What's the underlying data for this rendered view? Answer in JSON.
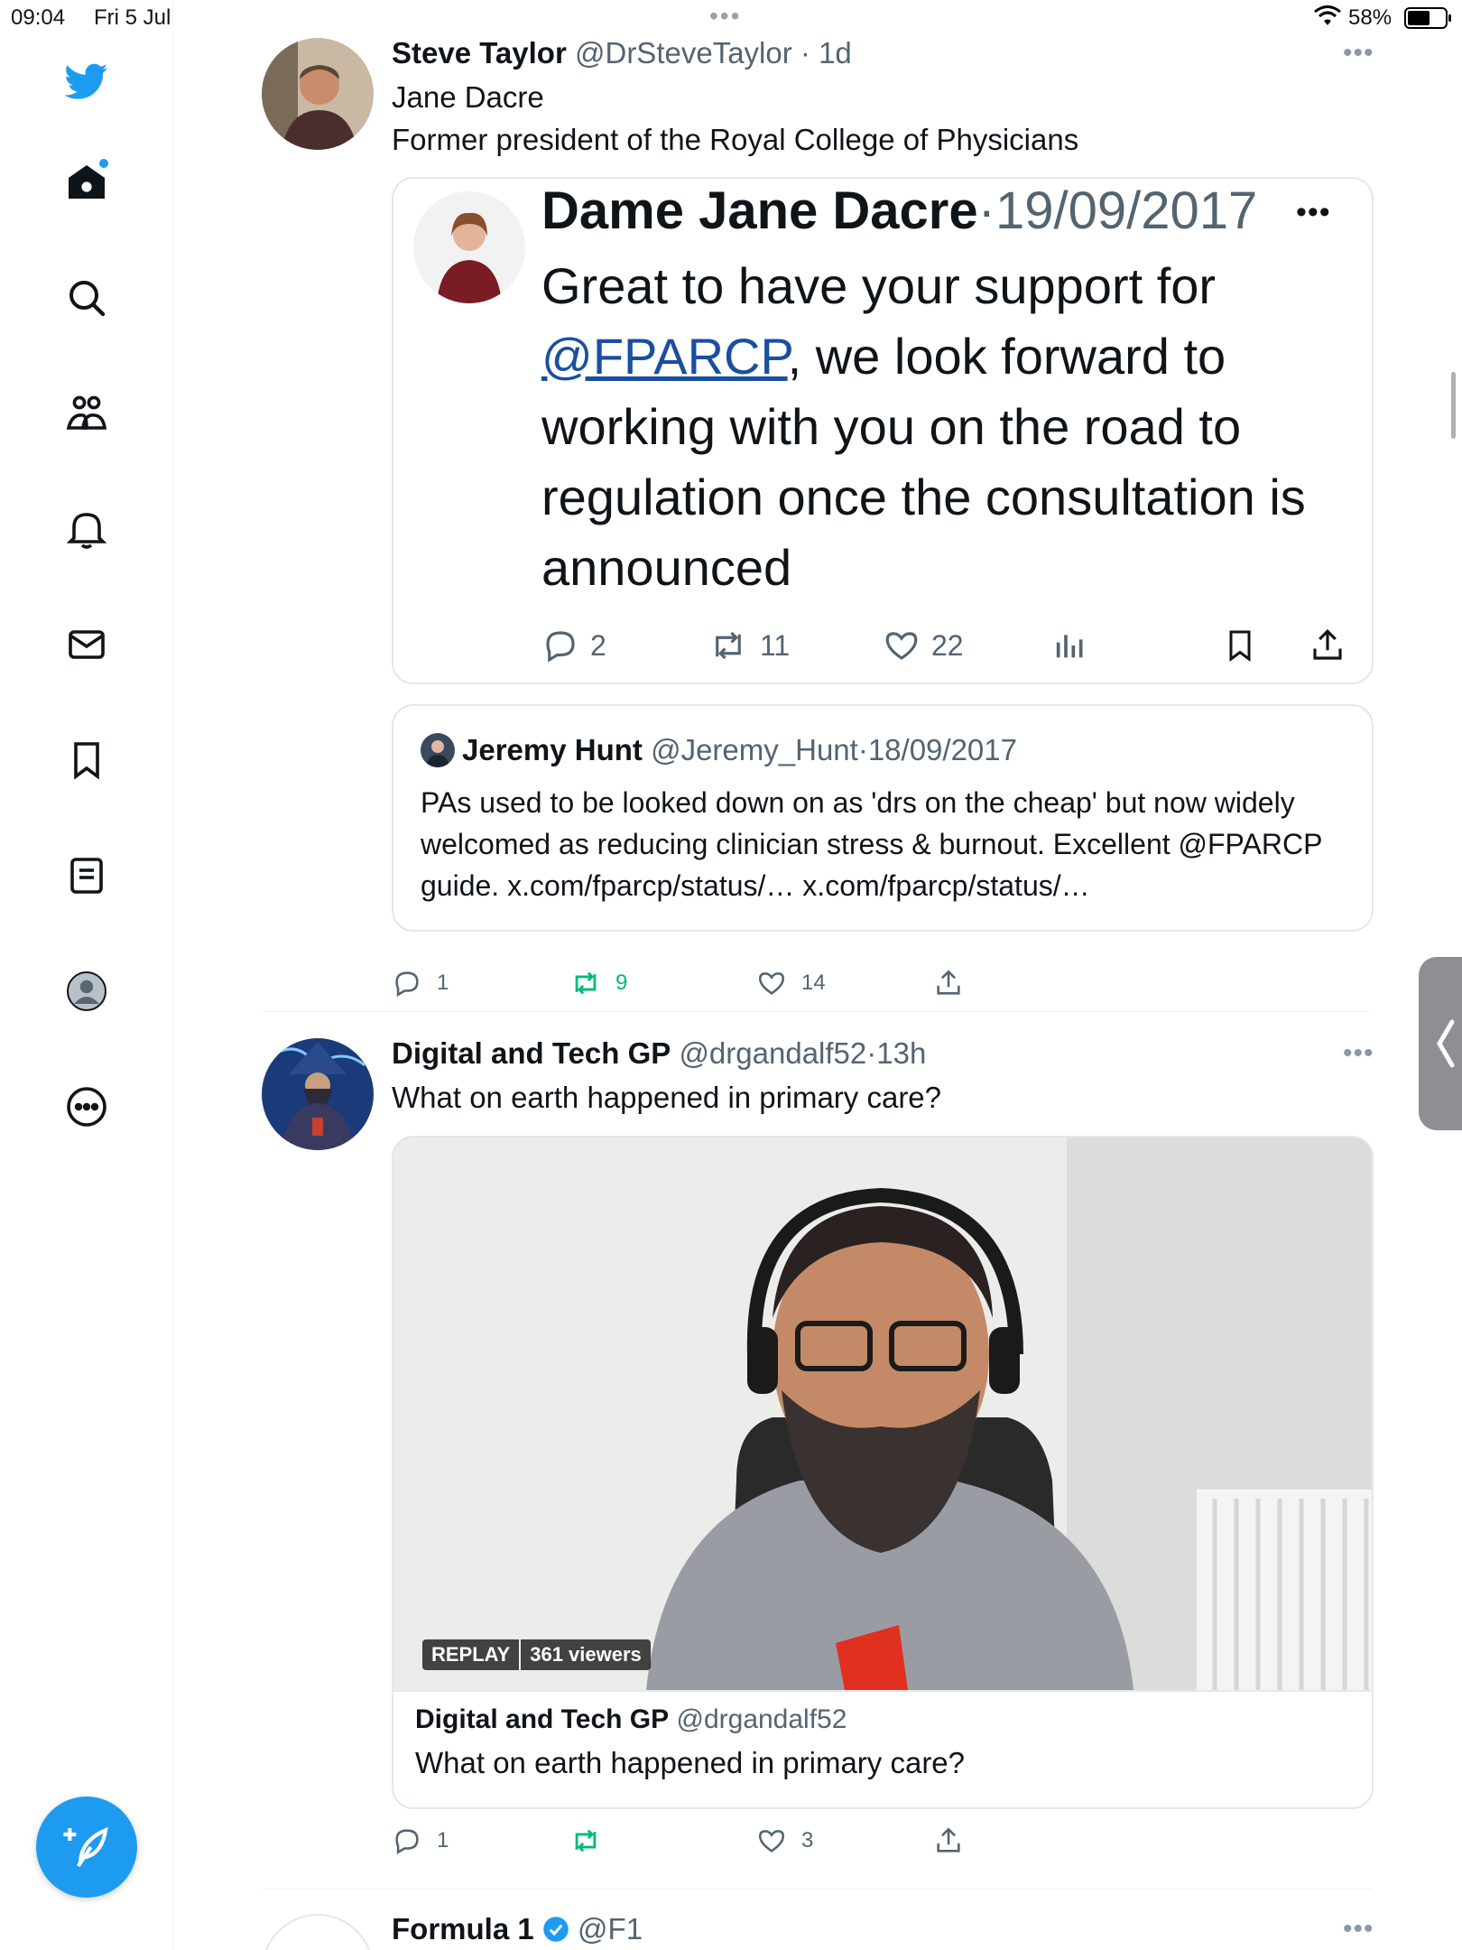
{
  "status_bar": {
    "time": "09:04",
    "date": "Fri 5 Jul",
    "dots": "•••",
    "battery_pct": "58%"
  },
  "sidebar": {
    "items": [
      {
        "icon": "twitter-logo-icon"
      },
      {
        "icon": "home-icon"
      },
      {
        "icon": "search-icon"
      },
      {
        "icon": "communities-icon"
      },
      {
        "icon": "notifications-bell-icon"
      },
      {
        "icon": "messages-envelope-icon"
      },
      {
        "icon": "bookmarks-icon"
      },
      {
        "icon": "lists-icon"
      },
      {
        "icon": "profile-avatar-icon"
      },
      {
        "icon": "more-circle-icon"
      }
    ],
    "compose_icon": "compose-feather-icon"
  },
  "tweets": [
    {
      "name": "Steve Taylor",
      "handle": "@DrSteveTaylor",
      "sep": "·",
      "time": "1d",
      "more": "•••",
      "text_line1": "Jane Dacre",
      "text_line2": "Former president of the Royal College of Physicians",
      "screenshot": {
        "name": "Dame Jane Dacre",
        "sep": "·",
        "date": "19/09/2017",
        "more": "•••",
        "text_before": "Great to have your support for ",
        "mention": "@FPARCP",
        "text_after": ", we look forward to working with you on the road to regulation once the consultation is announced",
        "replies": "2",
        "retweets": "11",
        "likes": "22"
      },
      "quoted": {
        "name": "Jeremy Hunt",
        "handle": "@Jeremy_Hunt",
        "sep": "·",
        "date": "18/09/2017",
        "text": "PAs used to be looked down on as 'drs on the cheap' but now widely welcomed as reducing clinician stress & burnout. Excellent @FPARCP guide. x.com/fparcp/status/… x.com/fparcp/status/…"
      },
      "replies": "1",
      "retweets": "9",
      "likes": "14"
    },
    {
      "name": "Digital and Tech GP",
      "handle": "@drgandalf52",
      "sep": "·",
      "time": "13h",
      "more": "•••",
      "text": "What on earth happened in primary care?",
      "video": {
        "replay": "REPLAY",
        "viewers": "361 viewers",
        "card_name": "Digital and Tech GP",
        "card_handle": "@drgandalf52",
        "card_text": "What on earth happened in primary care?"
      },
      "replies": "1",
      "likes": "3"
    },
    {
      "name": "Formula 1",
      "handle": "@F1",
      "more": "•••"
    }
  ],
  "colors": {
    "accent": "#1d9bf0",
    "retweet": "#00ba7c",
    "text": "#0f1419",
    "muted": "#536471"
  }
}
